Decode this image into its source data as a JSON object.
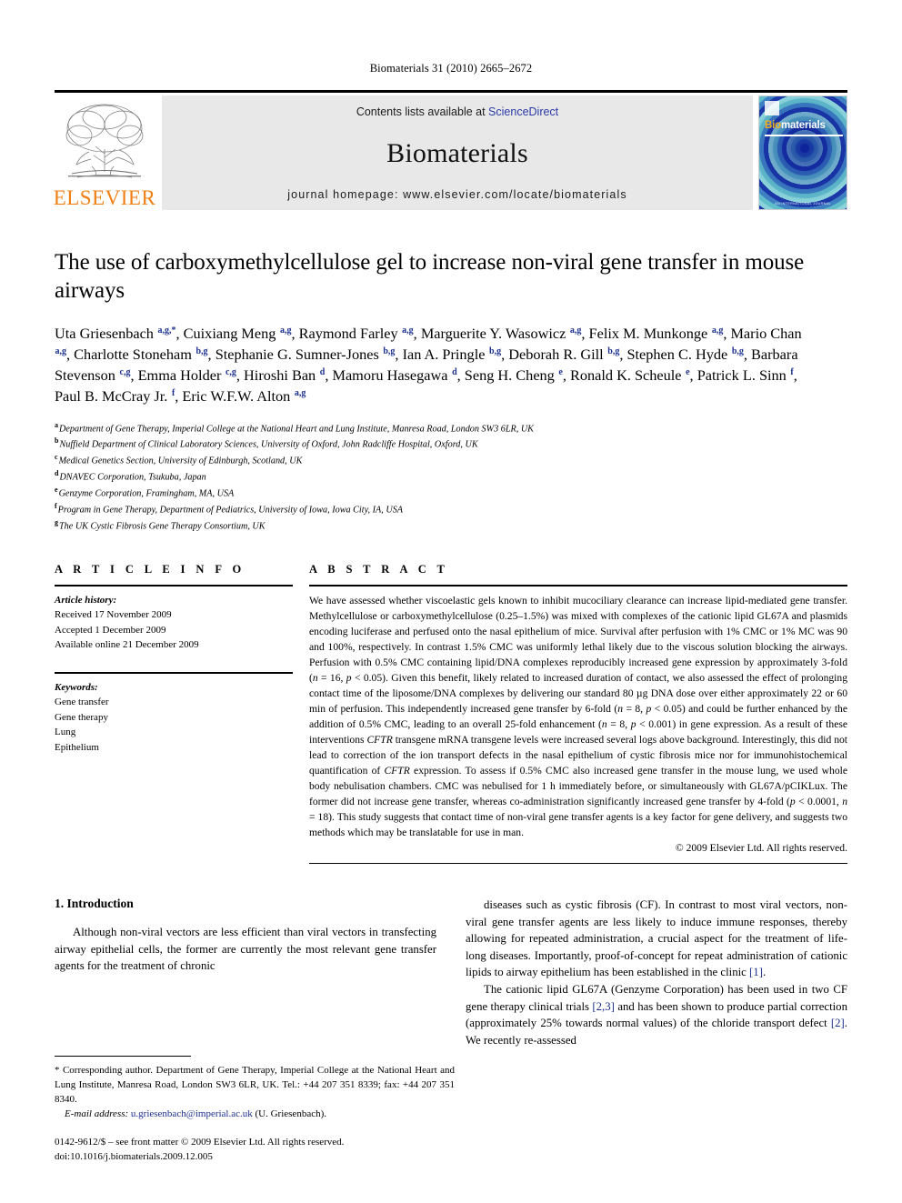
{
  "running_head": "Biomaterials 31 (2010) 2665–2672",
  "masthead": {
    "publisher_name": "ELSEVIER",
    "contents_prefix": "Contents lists available at ",
    "contents_link": "ScienceDirect",
    "journal_title": "Biomaterials",
    "homepage": "journal homepage: www.elsevier.com/locate/biomaterials",
    "cover": {
      "title_first": "Bio",
      "title_rest": "materials",
      "footer": "AN INTERNATIONAL JOURNAL"
    },
    "link_color": "#2b39a8",
    "elsevier_color": "#F07F13"
  },
  "article": {
    "title": "The use of carboxymethylcellulose gel to increase non-viral gene transfer in mouse airways",
    "authors_html": "Uta Griesenbach <sup>a,g,*</sup>, Cuixiang Meng <sup>a,g</sup>, Raymond Farley <sup>a,g</sup>, Marguerite Y. Wasowicz <sup>a,g</sup>, Felix M. Munkonge <sup>a,g</sup>, Mario Chan <sup>a,g</sup>, Charlotte Stoneham <sup>b,g</sup>, Stephanie G. Sumner-Jones <sup>b,g</sup>, Ian A. Pringle <sup>b,g</sup>, Deborah R. Gill <sup>b,g</sup>, Stephen C. Hyde <sup>b,g</sup>, Barbara Stevenson <sup>c,g</sup>, Emma Holder <sup>c,g</sup>, Hiroshi Ban <sup>d</sup>, Mamoru Hasegawa <sup>d</sup>, Seng H. Cheng <sup>e</sup>, Ronald K. Scheule <sup>e</sup>, Patrick L. Sinn <sup>f</sup>, Paul B. McCray Jr. <sup>f</sup>, Eric W.F.W. Alton <sup>a,g</sup>",
    "affiliations": [
      {
        "mark": "a",
        "text": "Department of Gene Therapy, Imperial College at the National Heart and Lung Institute, Manresa Road, London SW3 6LR, UK"
      },
      {
        "mark": "b",
        "text": "Nuffield Department of Clinical Laboratory Sciences, University of Oxford, John Radcliffe Hospital, Oxford, UK"
      },
      {
        "mark": "c",
        "text": "Medical Genetics Section, University of Edinburgh, Scotland, UK"
      },
      {
        "mark": "d",
        "text": "DNAVEC Corporation, Tsukuba, Japan"
      },
      {
        "mark": "e",
        "text": "Genzyme Corporation, Framingham, MA, USA"
      },
      {
        "mark": "f",
        "text": "Program in Gene Therapy, Department of Pediatrics, University of Iowa, Iowa City, IA, USA"
      },
      {
        "mark": "g",
        "text": "The UK Cystic Fibrosis Gene Therapy Consortium, UK"
      }
    ]
  },
  "article_info": {
    "heading": "A R T I C L E   I N F O",
    "history_label": "Article history:",
    "history": [
      "Received 17 November 2009",
      "Accepted 1 December 2009",
      "Available online 21 December 2009"
    ],
    "keywords_label": "Keywords:",
    "keywords": [
      "Gene transfer",
      "Gene therapy",
      "Lung",
      "Epithelium"
    ]
  },
  "abstract": {
    "heading": "A B S T R A C T",
    "text_html": "We have assessed whether viscoelastic gels known to inhibit mucociliary clearance can increase lipid-mediated gene transfer. Methylcellulose or carboxymethylcellulose (0.25–1.5%) was mixed with complexes of the cationic lipid GL67A and plasmids encoding luciferase and perfused onto the nasal epithelium of mice. Survival after perfusion with 1% CMC or 1% MC was 90 and 100%, respectively. In contrast 1.5% CMC was uniformly lethal likely due to the viscous solution blocking the airways. Perfusion with 0.5% CMC containing lipid/DNA complexes reproducibly increased gene expression by approximately 3-fold (<i>n</i> = 16, <i>p</i> &lt; 0.05). Given this benefit, likely related to increased duration of contact, we also assessed the effect of prolonging contact time of the liposome/DNA complexes by delivering our standard 80 µg DNA dose over either approximately 22 or 60 min of perfusion. This independently increased gene transfer by 6-fold (<i>n</i> = 8, <i>p</i> &lt; 0.05) and could be further enhanced by the addition of 0.5% CMC, leading to an overall 25-fold enhancement (<i>n</i> = 8, <i>p</i> &lt; 0.001) in gene expression. As a result of these interventions <i>CFTR</i> transgene mRNA transgene levels were increased several logs above background. Interestingly, this did not lead to correction of the ion transport defects in the nasal epithelium of cystic fibrosis mice nor for immunohistochemical quantification of <i>CFTR</i> expression. To assess if 0.5% CMC also increased gene transfer in the mouse lung, we used whole body nebulisation chambers. CMC was nebulised for 1 h immediately before, or simultaneously with GL67A/pCIKLux. The former did not increase gene transfer, whereas co-administration significantly increased gene transfer by 4-fold (<i>p</i> &lt; 0.0001, <i>n</i> = 18). This study suggests that contact time of non-viral gene transfer agents is a key factor for gene delivery, and suggests two methods which may be translatable for use in man.",
    "copyright": "© 2009 Elsevier Ltd. All rights reserved."
  },
  "body": {
    "section_number_title": "1.  Introduction",
    "left_paragraph": "Although non-viral vectors are less efficient than viral vectors in transfecting airway epithelial cells, the former are currently the most relevant gene transfer agents for the treatment of chronic",
    "right_paragraph_1_html": "diseases such as cystic fibrosis (CF). In contrast to most viral vectors, non-viral gene transfer agents are less likely to induce immune responses, thereby allowing for repeated administration, a crucial aspect for the treatment of life-long diseases. Importantly, proof-of-concept for repeat administration of cationic lipids to airway epithelium has been established in the clinic <span class=\"ref\">[1]</span>.",
    "right_paragraph_2_html": "The cationic lipid GL67A (Genzyme Corporation) has been used in two CF gene therapy clinical trials <span class=\"ref\">[2,3]</span> and has been shown to produce partial correction (approximately 25% towards normal values) of the chloride transport defect <span class=\"ref\">[2]</span>. We recently re-assessed"
  },
  "footnotes": {
    "corresponding_html": "* Corresponding author. Department of Gene Therapy, Imperial College at the National Heart and Lung Institute, Manresa Road, London SW3 6LR, UK. Tel.: +44 207 351 8339; fax: +44 207 351 8340.",
    "email_label": "E-mail address:",
    "email": "u.griesenbach@imperial.ac.uk",
    "email_owner": "(U. Griesenbach).",
    "imprint_line_1": "0142-9612/$ – see front matter © 2009 Elsevier Ltd. All rights reserved.",
    "imprint_line_2": "doi:10.1016/j.biomaterials.2009.12.005"
  }
}
